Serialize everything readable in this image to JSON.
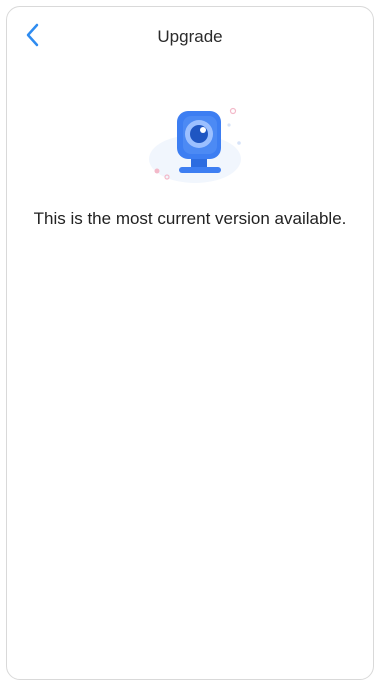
{
  "header": {
    "title": "Upgrade"
  },
  "icons": {
    "back": "chevron-left-icon",
    "illustration": "camera-icon"
  },
  "main": {
    "message": "This is the most current version available."
  },
  "colors": {
    "accent": "#2f8cf0",
    "camera_primary": "#3d7ef2",
    "camera_light": "#9cc0ff",
    "background": "#ffffff"
  }
}
